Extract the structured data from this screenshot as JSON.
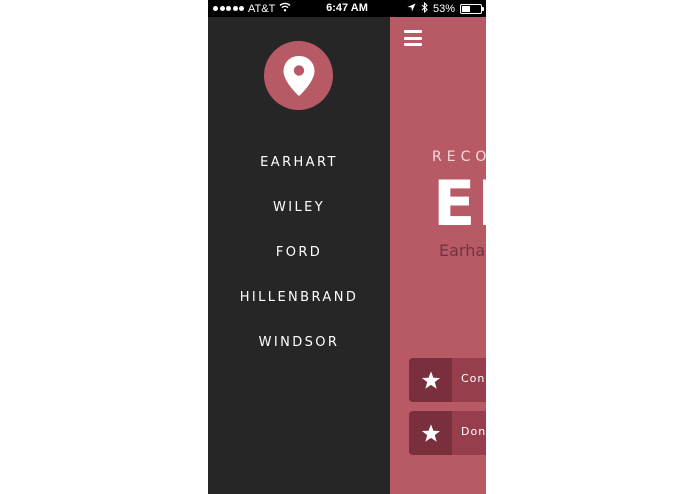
{
  "statusbar": {
    "carrier": "AT&T",
    "time": "6:47 AM",
    "battery_text": "53%",
    "battery_level": 0.53,
    "signal_bars": 5,
    "icons": [
      "signal-dots-icon",
      "wifi-icon",
      "location-arrow-icon",
      "bluetooth-icon",
      "battery-icon"
    ]
  },
  "drawer": {
    "logo_icon": "map-pin-icon",
    "items": [
      {
        "label": "EARHART"
      },
      {
        "label": "WILEY"
      },
      {
        "label": "FORD"
      },
      {
        "label": "HILLENBRAND"
      },
      {
        "label": "WINDSOR"
      }
    ]
  },
  "main": {
    "menu_icon": "hamburger-menu-icon",
    "eyebrow": "RECO",
    "title": "EI",
    "subtitle": "Earha",
    "actions": [
      {
        "label": "Cong",
        "icon": "star-icon"
      },
      {
        "label": "Don",
        "icon": "star-icon"
      }
    ]
  },
  "colors": {
    "accent": "#b85a66",
    "drawer_bg": "#262626",
    "action_bg": "#963e4c",
    "action_icon_bg": "#792f3c",
    "subtitle_text": "#6e3440"
  }
}
